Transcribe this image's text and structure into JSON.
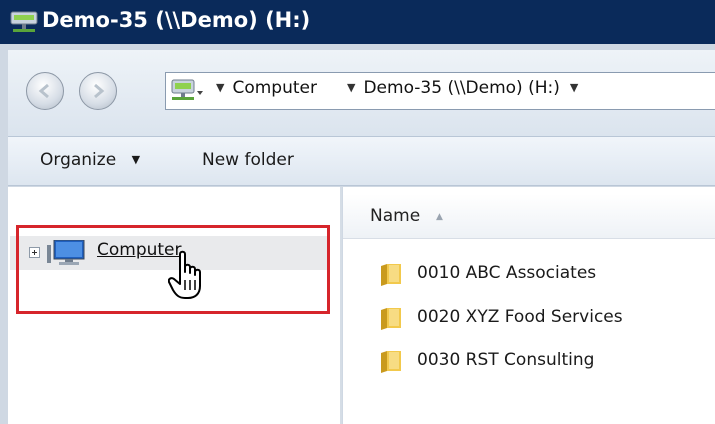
{
  "window": {
    "title": "Demo-35 (\\\\Demo) (H:)"
  },
  "address_bar": {
    "segments": [
      "Computer",
      "Demo-35 (\\\\Demo) (H:)"
    ]
  },
  "toolbar": {
    "organize_label": "Organize",
    "new_folder_label": "New folder"
  },
  "nav_pane": {
    "items": [
      {
        "label": "Computer"
      }
    ]
  },
  "file_list": {
    "column_name": "Name",
    "items": [
      {
        "name": "0010 ABC Associates"
      },
      {
        "name": "0020 XYZ Food Services"
      },
      {
        "name": "0030 RST Consulting"
      }
    ]
  },
  "colors": {
    "title_bar": "#0a2a5a",
    "highlight_box": "#d6252b",
    "folder": "#f2c94c"
  },
  "icons": [
    "network-drive-icon",
    "back-icon",
    "forward-icon",
    "dropdown-icon",
    "expand-icon",
    "computer-icon",
    "hand-cursor-icon",
    "folder-icon"
  ]
}
